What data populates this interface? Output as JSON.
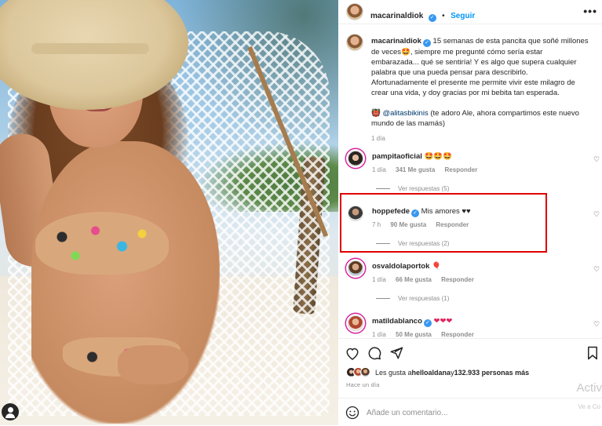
{
  "post": {
    "author": "macarinaldiok",
    "follow_label": "Seguir",
    "more_label": "•••",
    "caption_user": "macarinaldiok",
    "caption_line1": " 15 semanas de esta pancita que soñé millones",
    "caption_line2": "de veces🤩, siempre me pregunté cómo sería estar",
    "caption_line3": "embarazada... qué se sentiría! Y es algo que supera cualquier",
    "caption_line4": "palabra que una pueda pensar para describirlo.",
    "caption_line5": "Afortunadamente el presente me permite vivir este milagro de",
    "caption_line6": "crear una vida, y doy gracias por mi bebita tan esperada.",
    "caption_mention_prefix": "👹 ",
    "caption_mention": "@alitasbikinis",
    "caption_mention_rest": " (te adoro Ale, ahora compartimos este nuevo",
    "caption_line8": "mundo de las mamás)",
    "caption_time": "1 día"
  },
  "comments": [
    {
      "user": "pampitaoficial",
      "verified": false,
      "text": " 🤩🤩🤩",
      "time": "1 día",
      "likes": "341 Me gusta",
      "reply": "Responder",
      "replies": "Ver respuestas (5)"
    },
    {
      "user": "hoppefede",
      "verified": true,
      "text": " Mis amores ♥♥",
      "time": "7 h",
      "likes": "90 Me gusta",
      "reply": "Responder",
      "replies": "Ver respuestas (2)"
    },
    {
      "user": "osvaldolaportok",
      "verified": false,
      "text": " 🎈",
      "time": "1 día",
      "likes": "66 Me gusta",
      "reply": "Responder",
      "replies": "Ver respuestas (1)"
    },
    {
      "user": "matildablanco",
      "verified": true,
      "text": " ❤❤❤",
      "time": "1 día",
      "likes": "50 Me gusta",
      "reply": "Responder"
    }
  ],
  "likes": {
    "prefix": "Les gusta a ",
    "user": "helloaldana",
    "middle": " y ",
    "count": "132.933 personas más"
  },
  "posted_ago": "Hace un día",
  "comment_input": {
    "placeholder": "Añade un comentario..."
  },
  "watermark": {
    "line1": "Activ",
    "line2": "Ve a Co"
  },
  "colors": {
    "accent": "#0095f6",
    "highlight": "#e00000",
    "verified": "#3897f0"
  }
}
